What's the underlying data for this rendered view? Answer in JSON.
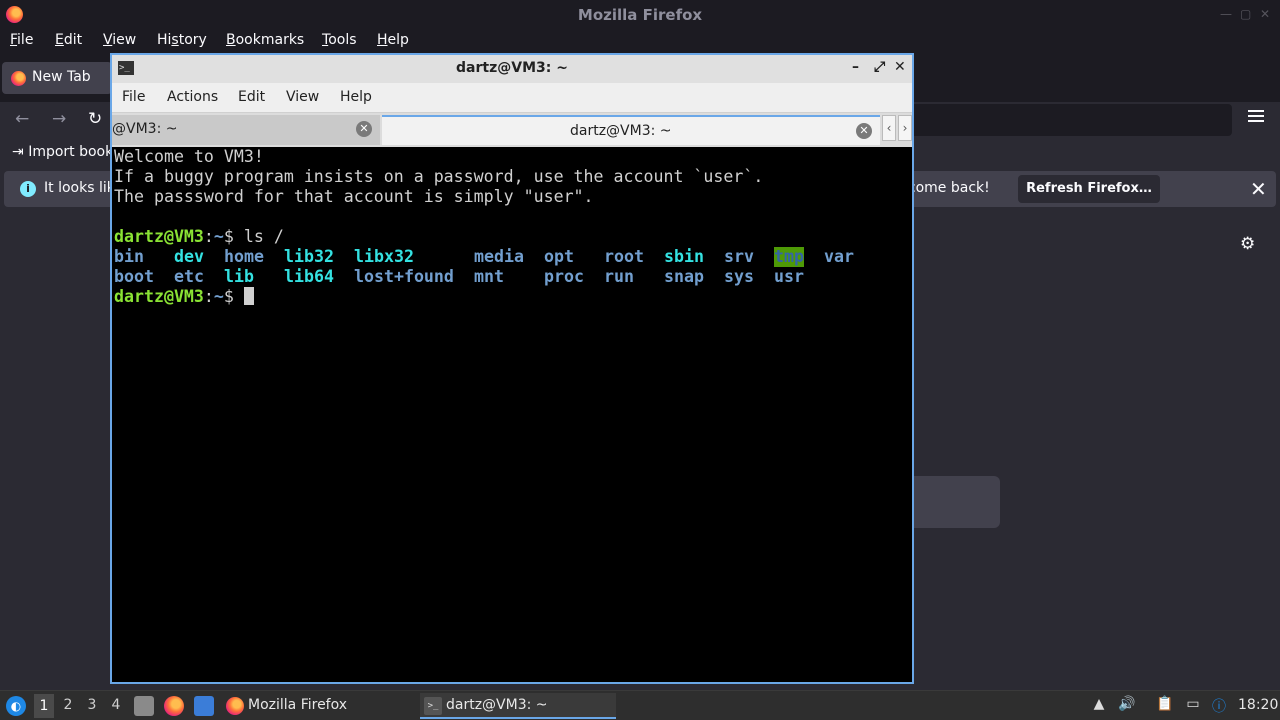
{
  "firefox": {
    "window_title": "Mozilla Firefox",
    "menu": [
      {
        "prefix": "",
        "u": "F",
        "rest": "ile"
      },
      {
        "prefix": "",
        "u": "E",
        "rest": "dit"
      },
      {
        "prefix": "",
        "u": "V",
        "rest": "iew"
      },
      {
        "prefix": "Hi",
        "u": "s",
        "rest": "tory"
      },
      {
        "prefix": "",
        "u": "B",
        "rest": "ookmarks"
      },
      {
        "prefix": "",
        "u": "T",
        "rest": "ools"
      },
      {
        "prefix": "",
        "u": "H",
        "rest": "elp"
      }
    ],
    "tab_label": "New Tab",
    "bookmark_import": "Import book",
    "notice_text_left": "It looks lik",
    "notice_text_right": "lcome back!",
    "refresh_button": "Refresh Firefox…"
  },
  "terminal": {
    "window_title": "dartz@VM3: ~",
    "menu": [
      "File",
      "Actions",
      "Edit",
      "View",
      "Help"
    ],
    "tabs": [
      {
        "label": "@VM3: ~",
        "active": false
      },
      {
        "label": "dartz@VM3: ~",
        "active": true
      }
    ],
    "lines": [
      "Welcome to VM3!",
      "If a buggy program insists on a password, use the account `user`.",
      "The passsword for that account is simply \"user\"."
    ],
    "prompt_user": "dartz@VM3",
    "prompt_sep": ":",
    "prompt_path": "~",
    "prompt_end": "$ ",
    "command": "ls /",
    "ls_row1": [
      "bin",
      "dev",
      "home",
      "lib32",
      "libx32",
      "media",
      "opt",
      "root",
      "sbin",
      "srv",
      "tmp",
      "var"
    ],
    "ls_row2": [
      "boot",
      "etc",
      "lib",
      "lib64",
      "lost+found",
      "mnt",
      "proc",
      "run",
      "snap",
      "sys",
      "usr"
    ]
  },
  "taskbar": {
    "workspaces": [
      "1",
      "2",
      "3",
      "4"
    ],
    "active_workspace": "1",
    "tasks": [
      "Mozilla Firefox",
      "dartz@VM3: ~"
    ],
    "clock": "18:20"
  },
  "colors": {
    "prompt_green": "#8ae234",
    "dir_blue": "#729fcf",
    "link_cyan": "#34e2e2",
    "accent": "#6aa7e8"
  }
}
